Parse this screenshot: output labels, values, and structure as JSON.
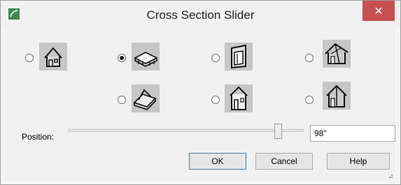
{
  "window": {
    "title": "Cross Section Slider",
    "close_symbol": "✕"
  },
  "options": [
    {
      "icon": "house-exterior-icon",
      "selected": false
    },
    {
      "icon": "floor-slice-icon",
      "selected": true
    },
    {
      "icon": "wall-section-icon",
      "selected": false
    },
    {
      "icon": "roof-cutaway-icon",
      "selected": false
    },
    {
      "icon": "house-base-cutaway-icon",
      "selected": false
    },
    {
      "icon": "house-side-cut-icon",
      "selected": false
    },
    {
      "icon": "house-vertical-cut-icon",
      "selected": false
    }
  ],
  "position": {
    "label": "Position:",
    "value": "98\"",
    "slider_fraction": 0.88
  },
  "buttons": {
    "ok": "OK",
    "cancel": "Cancel",
    "help": "Help"
  },
  "colors": {
    "close_bg": "#c75050",
    "tile_bg": "#c6c6c6"
  }
}
